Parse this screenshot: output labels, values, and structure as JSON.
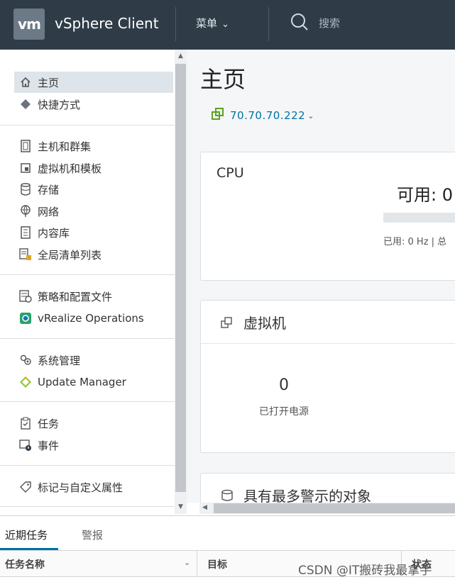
{
  "header": {
    "logo_text": "vm",
    "app_title": "vSphere Client",
    "menu_label": "菜单",
    "search_label": "搜索"
  },
  "sidebar": {
    "groups": [
      [
        {
          "label": "主页",
          "icon": "home-icon",
          "active": true
        },
        {
          "label": "快捷方式",
          "icon": "shortcuts-icon"
        }
      ],
      [
        {
          "label": "主机和群集",
          "icon": "hosts-clusters-icon"
        },
        {
          "label": "虚拟机和模板",
          "icon": "vm-templates-icon"
        },
        {
          "label": "存储",
          "icon": "storage-icon"
        },
        {
          "label": "网络",
          "icon": "network-icon"
        },
        {
          "label": "内容库",
          "icon": "content-library-icon"
        },
        {
          "label": "全局清单列表",
          "icon": "global-inventory-icon"
        }
      ],
      [
        {
          "label": "策略和配置文件",
          "icon": "policies-icon"
        },
        {
          "label": "vRealize Operations",
          "icon": "vrealize-icon"
        }
      ],
      [
        {
          "label": "系统管理",
          "icon": "administration-icon"
        },
        {
          "label": "Update Manager",
          "icon": "update-manager-icon"
        }
      ],
      [
        {
          "label": "任务",
          "icon": "tasks-icon"
        },
        {
          "label": "事件",
          "icon": "events-icon"
        }
      ],
      [
        {
          "label": "标记与自定义属性",
          "icon": "tags-icon"
        }
      ]
    ]
  },
  "main": {
    "title": "主页",
    "host": "70.70.70.222",
    "cpu": {
      "title": "CPU",
      "available": "可用: 0",
      "used_line": "已用: 0 Hz | 总"
    },
    "vms": {
      "title": "虚拟机",
      "powered_on_count": "0",
      "powered_on_label": "已打开电源"
    },
    "alarms": {
      "title": "具有最多警示的对象"
    }
  },
  "bottom_panel": {
    "tabs": [
      "近期任务",
      "警报"
    ],
    "columns": [
      "任务名称",
      "目标",
      "状态"
    ]
  },
  "watermark": "CSDN @IT搬砖我最拿手",
  "colors": {
    "topbar": "#2f3c48",
    "link": "#0072a3",
    "active_item": "#dde4ea",
    "host_icon": "#5aa220"
  }
}
